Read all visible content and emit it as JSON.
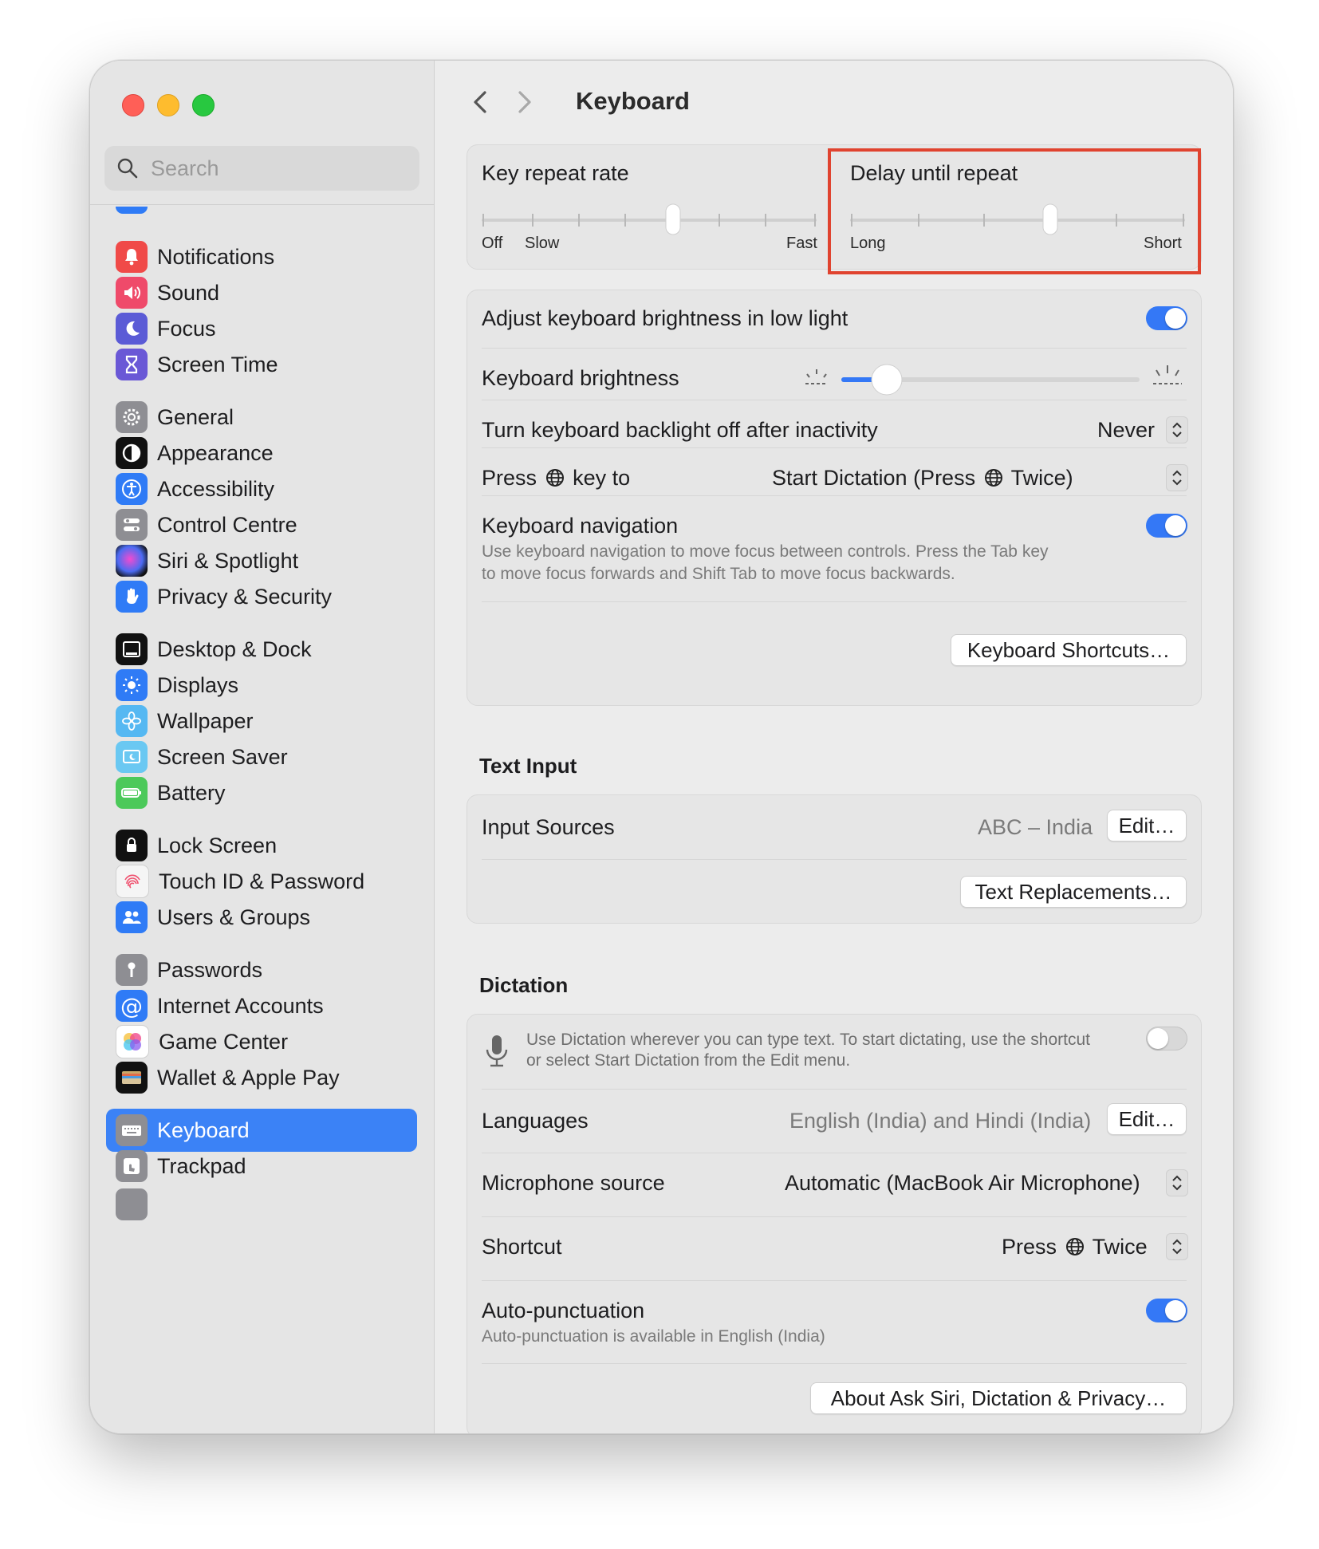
{
  "window": {
    "title": "Keyboard"
  },
  "search": {
    "placeholder": "Search"
  },
  "sidebar": {
    "items": [
      {
        "label": "Notifications",
        "color": "#f04a48"
      },
      {
        "label": "Sound",
        "color": "#ef4a6a"
      },
      {
        "label": "Focus",
        "color": "#5b5bd6"
      },
      {
        "label": "Screen Time",
        "color": "#6a58d6"
      },
      {
        "label": "General",
        "color": "#8e8e93"
      },
      {
        "label": "Appearance",
        "color": "#111111"
      },
      {
        "label": "Accessibility",
        "color": "#2f7bf6"
      },
      {
        "label": "Control Centre",
        "color": "#8e8e93"
      },
      {
        "label": "Siri & Spotlight",
        "color": "#7b3bd6"
      },
      {
        "label": "Privacy & Security",
        "color": "#2f7bf6"
      },
      {
        "label": "Desktop & Dock",
        "color": "#111111"
      },
      {
        "label": "Displays",
        "color": "#2f7bf6"
      },
      {
        "label": "Wallpaper",
        "color": "#55b8f2"
      },
      {
        "label": "Screen Saver",
        "color": "#6ac8f2"
      },
      {
        "label": "Battery",
        "color": "#4cc95a"
      },
      {
        "label": "Lock Screen",
        "color": "#111111"
      },
      {
        "label": "Touch ID & Password",
        "color": "#f5f5f5"
      },
      {
        "label": "Users & Groups",
        "color": "#2f7bf6"
      },
      {
        "label": "Passwords",
        "color": "#8e8e93"
      },
      {
        "label": "Internet Accounts",
        "color": "#2f7bf6"
      },
      {
        "label": "Game Center",
        "color": "#ffffff"
      },
      {
        "label": "Wallet & Apple Pay",
        "color": "#111111"
      },
      {
        "label": "Keyboard",
        "color": "#8e8e93",
        "active": true
      },
      {
        "label": "Trackpad",
        "color": "#8e8e93"
      }
    ]
  },
  "repeat": {
    "key_repeat_label": "Key repeat rate",
    "key_repeat_off": "Off",
    "key_repeat_slow": "Slow",
    "key_repeat_fast": "Fast",
    "delay_label": "Delay until repeat",
    "delay_long": "Long",
    "delay_short": "Short"
  },
  "settings": {
    "adjust_brightness_label": "Adjust keyboard brightness in low light",
    "brightness_label": "Keyboard brightness",
    "backlight_off_label": "Turn keyboard backlight off after inactivity",
    "backlight_off_value": "Never",
    "press_key_prefix": "Press",
    "press_key_suffix": "key to",
    "press_key_value_prefix": "Start Dictation (Press",
    "press_key_value_suffix": "Twice)",
    "nav_label": "Keyboard navigation",
    "nav_desc_1": "Use keyboard navigation to move focus between controls. Press the Tab key",
    "nav_desc_2": "to move focus forwards and Shift Tab to move focus backwards.",
    "shortcuts_button": "Keyboard Shortcuts…"
  },
  "text_input": {
    "title": "Text Input",
    "input_sources_label": "Input Sources",
    "input_sources_value": "ABC – India",
    "edit_button": "Edit…",
    "replacements_button": "Text Replacements…"
  },
  "dictation": {
    "title": "Dictation",
    "desc_1": "Use Dictation wherever you can type text. To start dictating, use the shortcut",
    "desc_2": "or select Start Dictation from the Edit menu.",
    "languages_label": "Languages",
    "languages_value": "English (India) and Hindi (India)",
    "edit_button": "Edit…",
    "mic_label": "Microphone source",
    "mic_value": "Automatic (MacBook Air Microphone)",
    "shortcut_label": "Shortcut",
    "shortcut_value_prefix": "Press",
    "shortcut_value_suffix": "Twice",
    "autopunct_label": "Auto-punctuation",
    "autopunct_desc": "Auto-punctuation is available in English (India)",
    "about_button": "About Ask Siri, Dictation & Privacy…"
  },
  "colors": {
    "accent": "#3478f6",
    "highlight": "#e0432f"
  }
}
